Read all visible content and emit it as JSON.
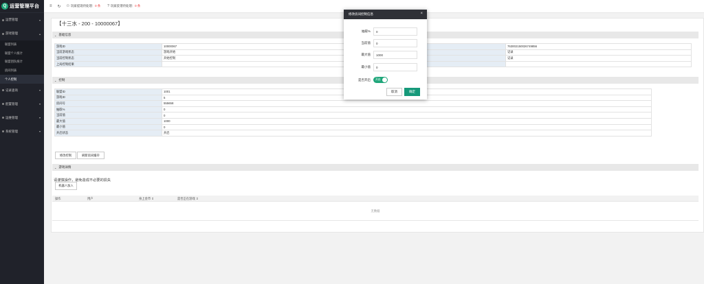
{
  "app": {
    "title": "运营管理平台",
    "logo_glyph": "Q"
  },
  "sidebar": {
    "items": [
      {
        "label": "运营管理",
        "caret": "▾"
      },
      {
        "label": "游戏管理",
        "caret": "▴",
        "expanded": true,
        "children": [
          {
            "label": "联盟列表"
          },
          {
            "label": "联盟个人统计"
          },
          {
            "label": "联盟团队统计"
          },
          {
            "label": "房间列表"
          },
          {
            "label": "个人控制",
            "active": true
          }
        ]
      },
      {
        "label": "记录查询",
        "caret": "▾"
      },
      {
        "label": "配置管理",
        "caret": "▾"
      },
      {
        "label": "运维管理",
        "caret": "▾"
      },
      {
        "label": "系统管理",
        "caret": "▾"
      }
    ]
  },
  "topbar": {
    "menu_icon": "≡",
    "refresh_icon": "↻",
    "info1": {
      "text": "玩家提现待处理：",
      "count": "0 条"
    },
    "info2": {
      "text": "玩家反馈待处理：",
      "count": "0 条"
    }
  },
  "page": {
    "title": "【十三水 - 200 - 10000067】",
    "basic_section": "基础信息",
    "basic_rows": [
      [
        "游戏ID",
        "10000067",
        "",
        "763002150026749856"
      ],
      [
        "当前游戏状态",
        "游戏开始",
        "",
        "记录"
      ],
      [
        "当前控制状态",
        "开始控制",
        "",
        "记录"
      ],
      [
        "上局控制结果",
        "",
        "",
        ""
      ]
    ],
    "control_section": "控制",
    "control_rows": [
      [
        "联盟ID",
        "1001"
      ],
      [
        "游戏ID",
        "5"
      ],
      [
        "房间号",
        "555658"
      ],
      [
        "抽取%",
        "0"
      ],
      [
        "当前值",
        "0"
      ],
      [
        "最大值",
        "1000"
      ],
      [
        "最小值",
        "0"
      ],
      [
        "开启状态",
        "开启"
      ]
    ],
    "btn_modify": "修改控制",
    "btn_refresh": "刷新房间缓存",
    "detail_section": "游戏详情",
    "notice": "请谨慎操作，避免造成不必要的损失",
    "btn_bot_join": "机器人加入",
    "list_cols": [
      "操作",
      "用户",
      "身上金币 ⇕",
      "是否正在游戏 ⇕"
    ],
    "empty_text": "无数据"
  },
  "modal": {
    "title": "修改房间控制信息",
    "close_glyph": "×",
    "fields": [
      {
        "label": "抽取%",
        "value": "0"
      },
      {
        "label": "当前值",
        "value": "0"
      },
      {
        "label": "最大值",
        "value": "1000"
      },
      {
        "label": "最小值",
        "value": "0"
      }
    ],
    "switch_label": "是否开启",
    "switch_text": "开启",
    "cancel": "取消",
    "ok": "确定"
  },
  "colors": {
    "accent": "#16997a",
    "sidebar_bg": "#20222a",
    "header_bg": "#2f3137"
  }
}
